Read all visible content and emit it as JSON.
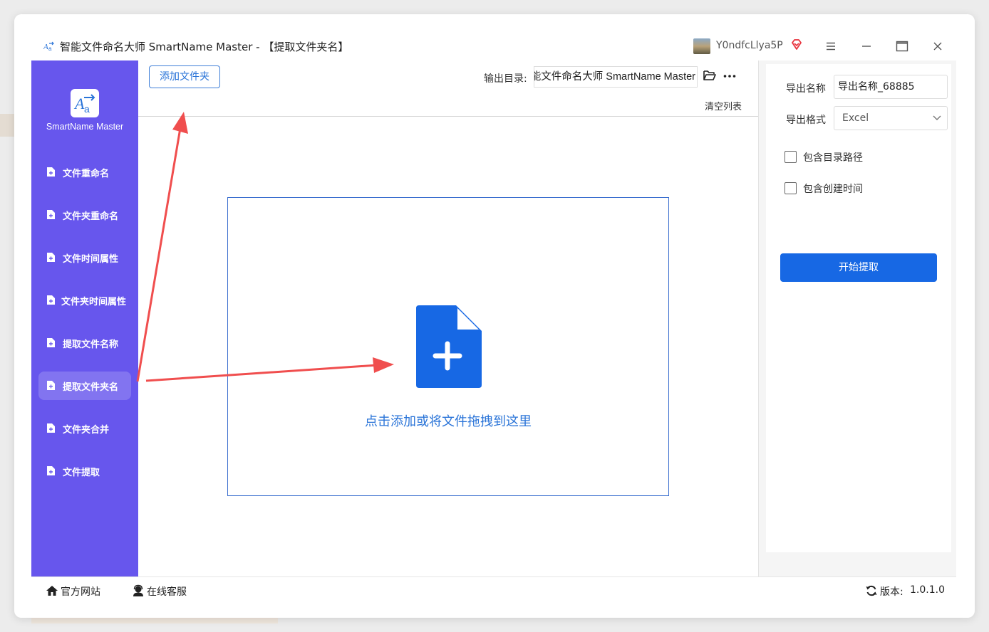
{
  "window": {
    "title": "智能文件命名大师 SmartName Master - 【提取文件夹名】",
    "user_name": "Y0ndfcLlya5P"
  },
  "sidebar": {
    "logo_text": "SmartName Master",
    "items": [
      {
        "label": "文件重命名",
        "active": false
      },
      {
        "label": "文件夹重命名",
        "active": false
      },
      {
        "label": "文件时间属性",
        "active": false
      },
      {
        "label": "文件夹时间属性",
        "active": false
      },
      {
        "label": "提取文件名称",
        "active": false
      },
      {
        "label": "提取文件夹名",
        "active": true
      },
      {
        "label": "文件夹合并",
        "active": false
      },
      {
        "label": "文件提取",
        "active": false
      }
    ]
  },
  "toolbar": {
    "add_folder_label": "添加文件夹",
    "output_dir_label": "输出目录:",
    "output_dir_value": "能文件命名大师 SmartName Master",
    "clear_list_label": "清空列表"
  },
  "drop_zone": {
    "text": "点击添加或将文件拖拽到这里"
  },
  "right_panel": {
    "export_name_label": "导出名称",
    "export_name_value": "导出名称_68885",
    "export_format_label": "导出格式",
    "export_format_value": "Excel",
    "include_dir_path_label": "包含目录路径",
    "include_create_time_label": "包含创建时间",
    "start_button_label": "开始提取"
  },
  "footer": {
    "website_label": "官方网站",
    "support_label": "在线客服",
    "version_label": "版本:",
    "version_value": "1.0.1.0"
  },
  "colors": {
    "sidebar_bg": "#6756ed",
    "accent_blue": "#1768e4",
    "link_blue": "#2a74d8",
    "annotation_red": "#f04e4e"
  }
}
